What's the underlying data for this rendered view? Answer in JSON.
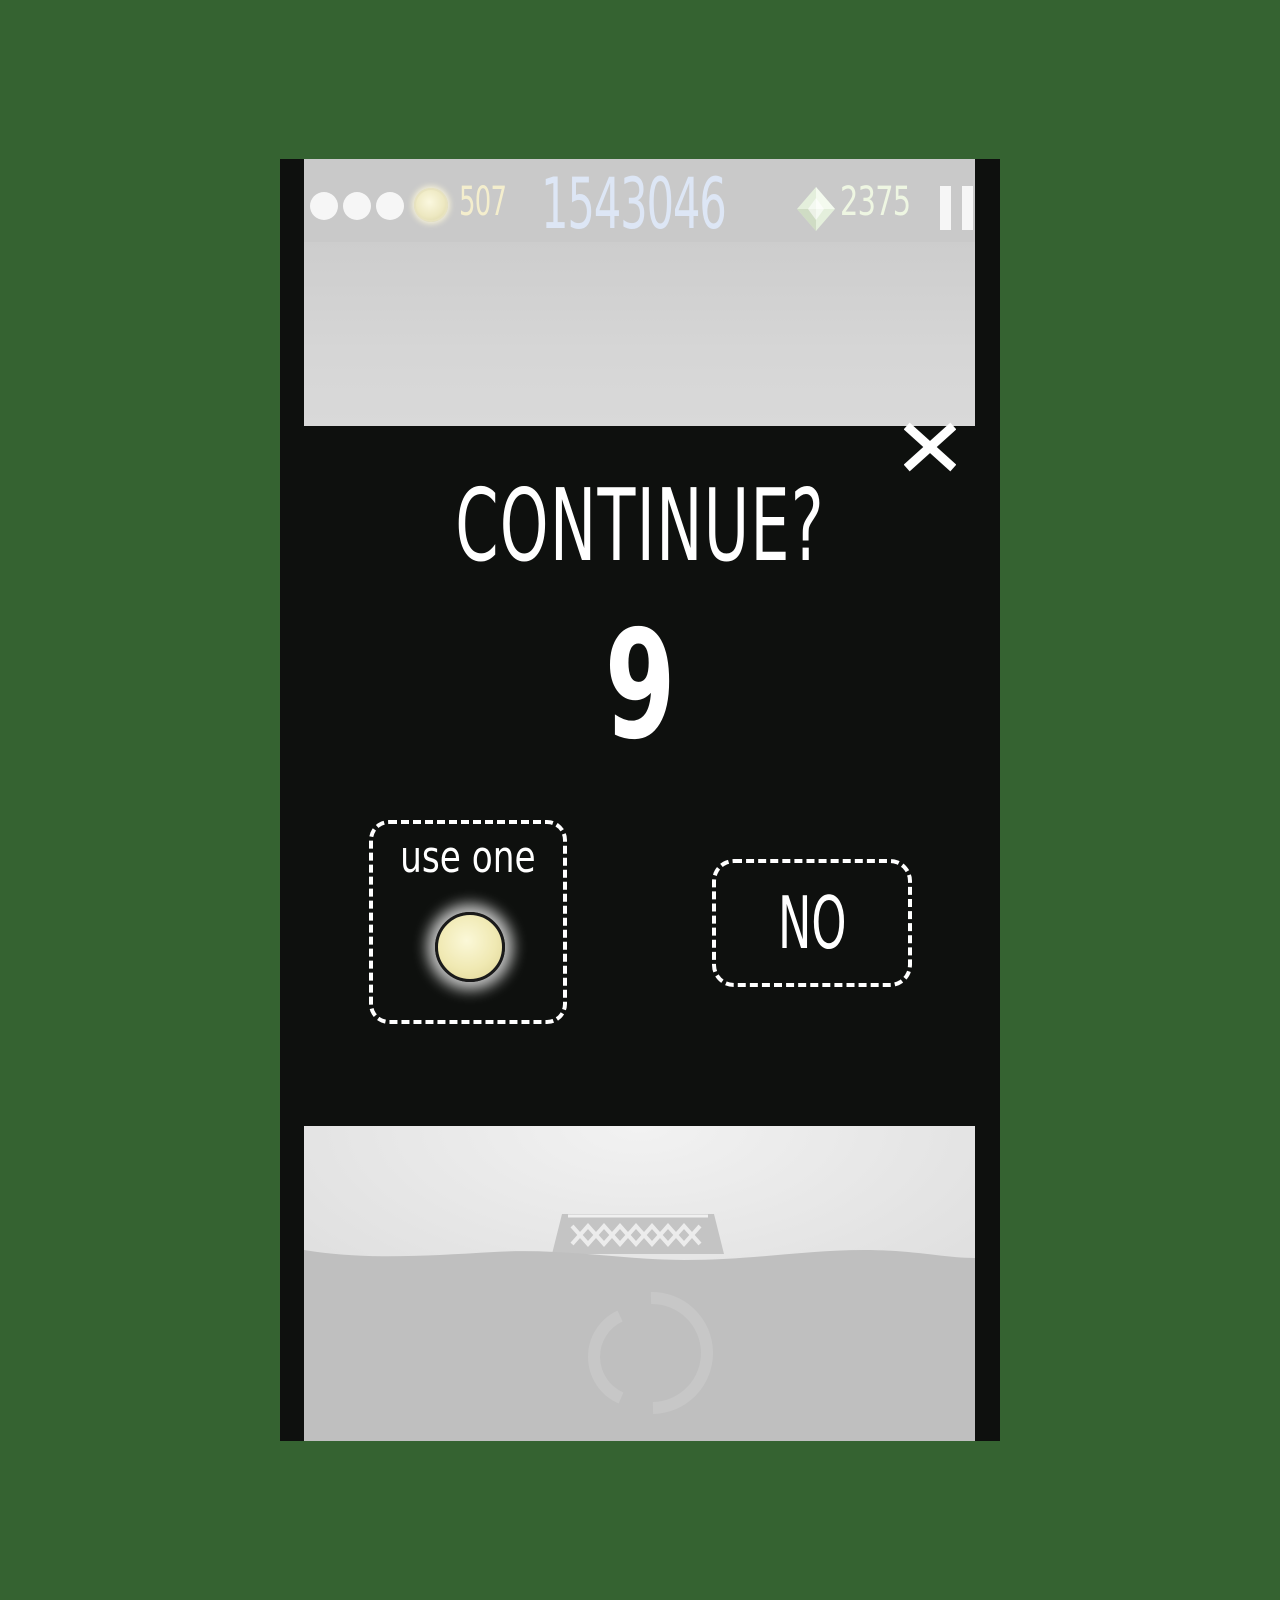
{
  "hud": {
    "lives_total": 3,
    "orb_count": "507",
    "score": "1543046",
    "gem_count": "2375",
    "pause_icon": "pause-icon"
  },
  "dialog": {
    "title": "CONTINUE?",
    "countdown": "9",
    "use_label": "use one",
    "no_label": "NO",
    "close_icon": "close-icon"
  },
  "colors": {
    "background": "#356331",
    "panel": "#0e100e",
    "hud_bar": "#c9c9c9",
    "score_text": "#dde6f5",
    "orb_text": "#f4eecd",
    "gem_text": "#eef6e2",
    "dialog_text": "#ffffff"
  },
  "icons": {
    "life": "life-dot-icon",
    "orb": "orb-icon",
    "gem": "gem-icon",
    "bridge": "bridge-icon",
    "ring": "ring-icon"
  }
}
